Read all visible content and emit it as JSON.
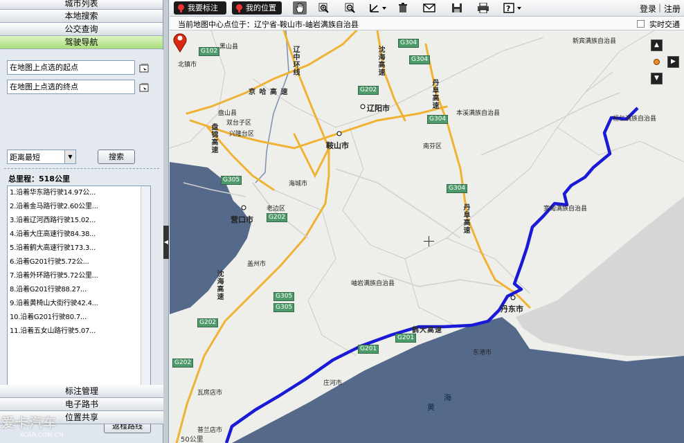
{
  "accordion_top": [
    "城市列表",
    "本地搜索",
    "公交查询",
    "驾驶导航"
  ],
  "route": {
    "start_value": "在地图上点选的起点",
    "end_value": "在地图上点选的终点",
    "sort_value": "距离最短",
    "search_label": "搜索",
    "total_label": "总里程：518公里",
    "steps": [
      "1.沿着华东路行驶14.97公...",
      "2.沿着金马路行驶2.60公里...",
      "3.沿着辽河西路行驶15.02...",
      "4.沿着大庄高速行驶84.38...",
      "5.沿着鹤大高速行驶173.3...",
      "6.沿着G201行驶5.72公...",
      "7.沿着外环路行驶5.72公里...",
      "8.沿着G201行驶88.27...",
      "9.沿着黄椅山大街行驶42.4...",
      "10.沿着G201行驶80.7...",
      "11.沿着五女山路行驶5.07..."
    ],
    "return_label": "返程路线"
  },
  "accordion_bottom": [
    "标注管理",
    "电子路书",
    "位置共享"
  ],
  "watermark": {
    "brand": "爱卡汽车",
    "url": "XCAR.COM.CN"
  },
  "toolbar": {
    "mark_label": "我要标注",
    "mylocation_label": "我的位置",
    "login_label": "登录",
    "divider": "|",
    "register_label": "注册",
    "tools": [
      "hand-pan-icon",
      "zoom-in-icon",
      "zoom-out-icon",
      "measure-icon",
      "delete-icon",
      "email-icon",
      "save-icon",
      "print-icon",
      "help-icon"
    ]
  },
  "infobar": {
    "center_label": "当前地图中心点位于：辽宁省-鞍山市-岫岩满族自治县",
    "traffic_label": "实时交通"
  },
  "map": {
    "cities": [
      "辽阳市",
      "鞍山市",
      "营口市",
      "丹东市"
    ],
    "places": [
      "新宾满族自治县",
      "黑山县",
      "北镇市",
      "盘山县",
      "双台子区",
      "兴隆台区",
      "本溪满族自治县",
      "桓仁满族自治县",
      "南芬区",
      "海城市",
      "老边区",
      "宽甸满族自治县",
      "盖州市",
      "岫岩满族自治县",
      "东港市",
      "庄河市",
      "瓦房店市",
      "普兰店市"
    ],
    "shields": [
      "G102",
      "G304",
      "G304",
      "G202",
      "G304",
      "G305",
      "G304",
      "G202",
      "G305",
      "G305",
      "G202",
      "G202",
      "G201",
      "G201"
    ],
    "road_words": [
      "京",
      "哈",
      "高",
      "速",
      "辽",
      "中",
      "环",
      "线",
      "沈",
      "海",
      "丹",
      "阜",
      "盘",
      "锦",
      "鹤",
      "大"
    ],
    "sea_words": [
      "黄",
      "海"
    ],
    "scale_label": "50公里",
    "colors": {
      "land": "#eeeeea",
      "sea": "#556a8a",
      "highway": "#f0b232",
      "route": "#1a1ad6",
      "boundary": "#c9c9c9"
    }
  }
}
